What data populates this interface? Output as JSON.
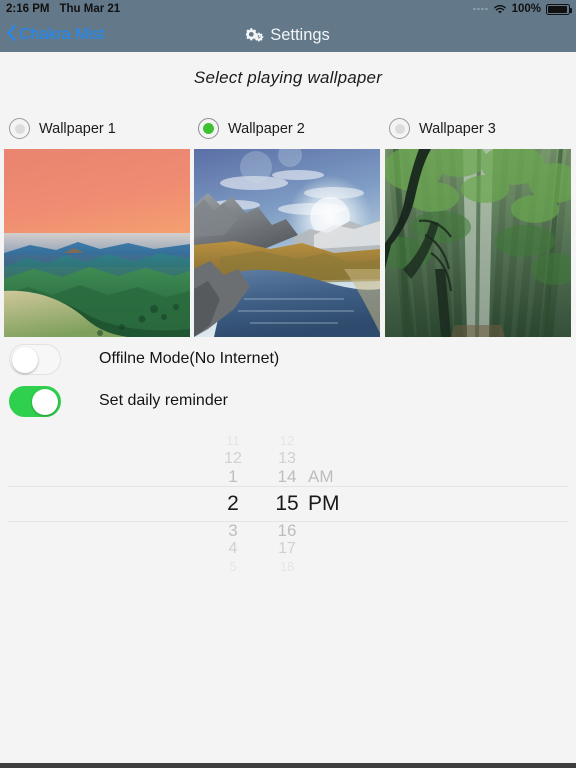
{
  "status_bar": {
    "time": "2:16 PM",
    "date": "Thu Mar 21",
    "battery_percent": "100%",
    "wifi_icon": "wifi-icon",
    "battery_icon": "battery-full-icon",
    "signal_icon": "signal-dots-icon",
    "bg_color": "#63798a"
  },
  "nav_bar": {
    "back_label": "Chakra Mist",
    "back_chevron_icon": "chevron-left-icon",
    "title": "Settings",
    "title_icon": "gears-icon",
    "tint_color": "#1b8cfe",
    "bg_color": "#63798a"
  },
  "main": {
    "section_title": "Select playing wallpaper",
    "wallpapers": [
      {
        "label": "Wallpaper 1",
        "selected": false,
        "scene": "sunset-mountains"
      },
      {
        "label": "Wallpaper 2",
        "selected": true,
        "scene": "alpine-lake"
      },
      {
        "label": "Wallpaper 3",
        "selected": false,
        "scene": "bamboo-forest"
      }
    ],
    "selected_color": "#3fc030",
    "toggles": [
      {
        "label": "Offilne Mode(No Internet)",
        "on": false
      },
      {
        "label": "Set daily reminder",
        "on": true
      }
    ],
    "toggle_on_color": "#2fd04e",
    "time_picker": {
      "selected_hour": "2",
      "selected_minute": "15",
      "selected_period": "PM",
      "hours": [
        "11",
        "12",
        "1",
        "2",
        "3",
        "4",
        "5"
      ],
      "minutes": [
        "12",
        "13",
        "14",
        "15",
        "16",
        "17",
        "18"
      ],
      "periods": [
        "AM",
        "PM"
      ]
    }
  }
}
